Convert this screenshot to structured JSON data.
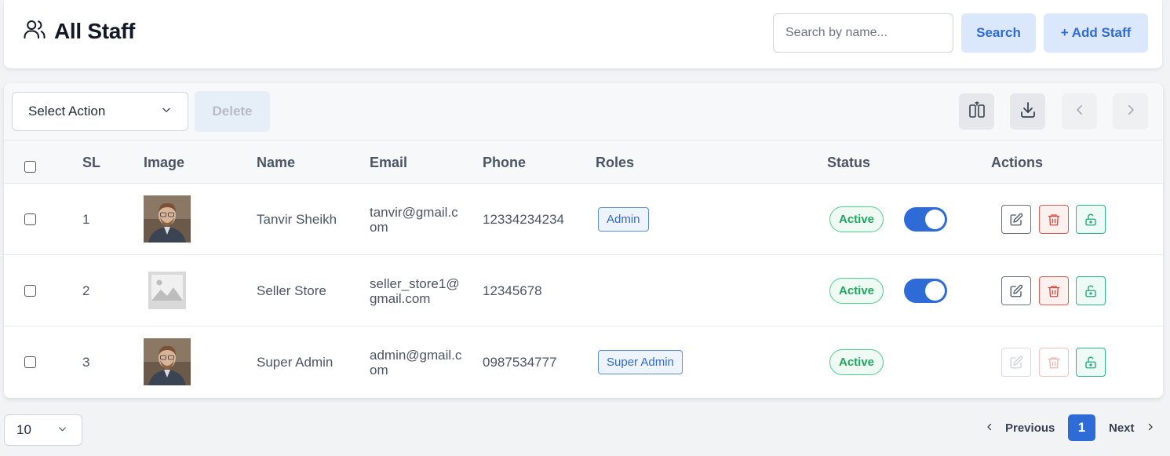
{
  "header": {
    "title": "All Staff",
    "search_placeholder": "Search by name...",
    "search_label": "Search",
    "add_label": "+ Add Staff"
  },
  "toolbar": {
    "select_action": "Select Action",
    "delete_label": "Delete"
  },
  "table": {
    "columns": [
      "SL",
      "Image",
      "Name",
      "Email",
      "Phone",
      "Roles",
      "Status",
      "Actions"
    ],
    "rows": [
      {
        "sl": "1",
        "image": "photo",
        "name": "Tanvir Sheikh",
        "email": "tanvir@gmail.com",
        "phone": "12334234234",
        "role": "Admin",
        "status": "Active",
        "toggle": true,
        "actions_enabled": true
      },
      {
        "sl": "2",
        "image": "placeholder",
        "name": "Seller Store",
        "email": "seller_store1@gmail.com",
        "phone": "12345678",
        "role": "",
        "status": "Active",
        "toggle": true,
        "actions_enabled": true
      },
      {
        "sl": "3",
        "image": "photo",
        "name": "Super Admin",
        "email": "admin@gmail.com",
        "phone": "0987534777",
        "role": "Super Admin",
        "status": "Active",
        "toggle": false,
        "actions_enabled": false
      }
    ]
  },
  "footer": {
    "page_size": "10",
    "previous_label": "Previous",
    "current_page": "1",
    "next_label": "Next"
  },
  "colors": {
    "accent": "#2e6bd6",
    "active_green": "#21a65f",
    "danger_red": "#e05c4f",
    "teal": "#2bb68a"
  }
}
